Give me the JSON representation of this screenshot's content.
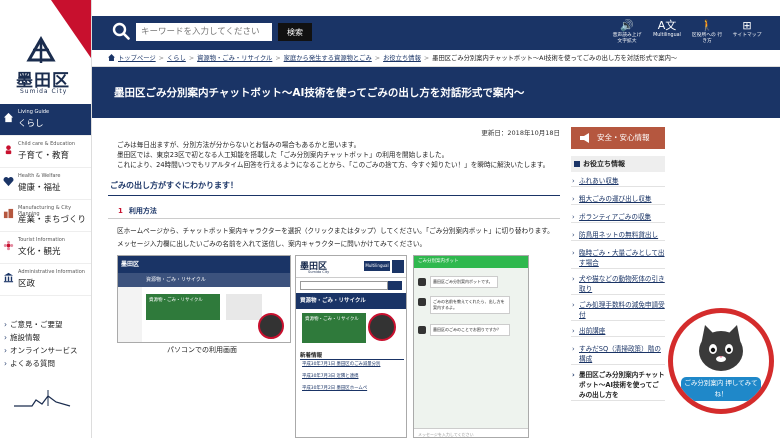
{
  "branding": {
    "logo_ja": "墨田区",
    "logo_en": "Sumida City",
    "brand_navy": "#1a3466",
    "accent_red": "#c8102e"
  },
  "sidebar": {
    "items": [
      {
        "en": "Living Guide",
        "ja": "くらし",
        "icon": "house-icon",
        "active": true
      },
      {
        "en": "Child care & Education",
        "ja": "子育て・教育",
        "icon": "child-care-icon",
        "active": false
      },
      {
        "en": "Health & Welfare",
        "ja": "健康・福祉",
        "icon": "heart-icon",
        "active": false
      },
      {
        "en": "Manufacturing & City Planning",
        "ja": "産業・まちづくり",
        "icon": "building-icon",
        "active": false
      },
      {
        "en": "Tourist Information",
        "ja": "文化・観光",
        "icon": "flower-icon",
        "active": false
      },
      {
        "en": "Administrative Information",
        "ja": "区政",
        "icon": "government-icon",
        "active": false
      }
    ],
    "links": [
      "ご意見・ご要望",
      "施設情報",
      "オンラインサービス",
      "よくある質問"
    ]
  },
  "header": {
    "search_placeholder": "キーワードを入力してください",
    "search_button": "検索",
    "tools": [
      {
        "label": "音声読み上げ 文字拡大",
        "icon": "speaker-icon"
      },
      {
        "label": "Multilingual",
        "icon": "translate-icon"
      },
      {
        "label": "区役所への 行き方",
        "icon": "walking-person-icon"
      },
      {
        "label": "サイトマップ",
        "icon": "sitemap-icon"
      }
    ]
  },
  "breadcrumb": [
    "トップページ",
    "くらし",
    "資源物・ごみ・リサイクル",
    "家庭から発生する資源物とごみ",
    "お役立ち情報",
    "墨田区ごみ分別案内チャットボット～AI技術を使ってごみの出し方を対話形式で案内～"
  ],
  "page": {
    "title": "墨田区ごみ分別案内チャットボット～AI技術を使ってごみの出し方を対話形式で案内～",
    "updated": "更新日：2018年10月18日",
    "intro": [
      "ごみは毎日出ますが、分別方法が分からないとお悩みの場合もあるかと思います。",
      "墨田区では、東京23区で初となる人工知能を搭載した「ごみ分別案内チャットボット」の利用を開始しました。",
      "これにより、24時間いつでもリアルタイム回答を行えるようになることから、「このごみの捨て方、今すぐ知りたい！」を瞬時に解決いたします。"
    ],
    "heading": "ごみの出し方がすぐにわかります！",
    "section_num": "1",
    "section_title": "利用方法",
    "usage": [
      "区ホームページから、チャットボット案内キャラクターを選択（クリックまたはタップ）してください。「ごみ分別案内ボット」に切り替わります。",
      "メッセージ入力欄に出したいごみの名前を入れて送信し、案内キャラクターに問いかけてみてください。"
    ],
    "pc_caption": "パソコンでの利用画面"
  },
  "screens": {
    "pc_logo": "墨田区",
    "pc_band": "資源物・ごみ・リサイクル",
    "pc_banner": "資源物・ごみ・リサイクル",
    "sp_logo": "墨田区",
    "sp_logo_en": "Sumida City",
    "sp_multilingual": "Multilingual",
    "sp_title": "資源物・ごみ・リサイクル",
    "sp_banner": "資源物・ごみ・リサイクル",
    "sp_news_title": "新着情報",
    "sp_news": [
      "平成30年7月1日 墨田区のごみ減量分別",
      "平成30年7月3日 近隣と連携",
      "平成30年7月2日 墨田区ホームペ"
    ],
    "chat_title": "ごみ分別案内ボット",
    "chat_messages": [
      "墨田区ごみ分別案内ボットです。",
      "ごみの名前を教えてくれたら、出し方を案内するよ。",
      "墨田区のごみのことでお困りですか？"
    ],
    "chat_input": "メッセージを入力してください"
  },
  "right_sidebar": {
    "safety": "安全・安心情報",
    "list_title": "お役立ち情報",
    "items": [
      "ふれあい収集",
      "粗大ごみの運び出し収集",
      "ボランティアごみの収集",
      "防鳥用ネットの無料貸出し",
      "臨時ごみ・大量ごみとして出す場合",
      "犬や猫などの動物死体の引き取り",
      "ごみ処理手数料の減免申請受付",
      "出前講座",
      "すみだSQ（清掃政策）階の構成",
      "墨田区ごみ分別案内チャットボット～AI技術を使ってごみの出し方を"
    ]
  },
  "mascot": {
    "ribbon": "ごみ分別案内 押してみてね！"
  }
}
